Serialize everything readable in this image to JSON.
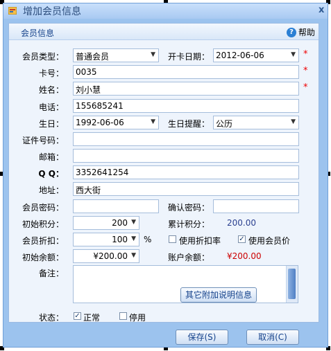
{
  "window": {
    "title": "增加会员信息",
    "close_glyph": "x"
  },
  "panel": {
    "title": "会员信息",
    "help_label": "帮助"
  },
  "form": {
    "member_type": {
      "label": "会员类型：",
      "value": "普通会员"
    },
    "open_date": {
      "label": "开卡日期：",
      "value": "2012-06-06"
    },
    "card_no": {
      "label": "卡号：",
      "value": "0035"
    },
    "name": {
      "label": "姓名：",
      "value": "刘小慧"
    },
    "phone": {
      "label": "电话：",
      "value": "155685241"
    },
    "birthday": {
      "label": "生日：",
      "value": "1992-06-06"
    },
    "birthday_reminder": {
      "label": "生日提醒：",
      "value": "公历"
    },
    "id_no": {
      "label": "证件号码：",
      "value": ""
    },
    "email": {
      "label": "邮箱：",
      "value": ""
    },
    "qq": {
      "label": "Q Q：",
      "value": "3352641254"
    },
    "address": {
      "label": "地址：",
      "value": "西大街"
    },
    "password": {
      "label": "会员密码：",
      "value": ""
    },
    "confirm_password": {
      "label": "确认密码：",
      "value": ""
    },
    "initial_points": {
      "label": "初始积分：",
      "value": "200"
    },
    "total_points": {
      "label": "累计积分：",
      "value": "200.00"
    },
    "discount": {
      "label": "会员折扣：",
      "value": "100",
      "unit": "%"
    },
    "use_discount_rate": {
      "label": "使用折扣率",
      "checked": false
    },
    "use_member_price": {
      "label": "使用会员价",
      "checked": true
    },
    "initial_balance": {
      "label": "初始余额：",
      "value": "¥200.00"
    },
    "account_balance": {
      "label": "账户余额：",
      "value": "¥200.00"
    },
    "remark": {
      "label": "备注：",
      "value": ""
    },
    "other_info_button": "其它附加说明信息",
    "status": {
      "label": "状态：",
      "normal": "正常",
      "disabled": "停用",
      "normal_checked": true,
      "disabled_checked": false
    },
    "required_mark": "*"
  },
  "buttons": {
    "save": "保存(S)",
    "cancel": "取消(C)"
  },
  "colors": {
    "accent": "#15428b",
    "required": "#ee0000",
    "balance": "#cc0000",
    "points": "#2a3f8f"
  }
}
